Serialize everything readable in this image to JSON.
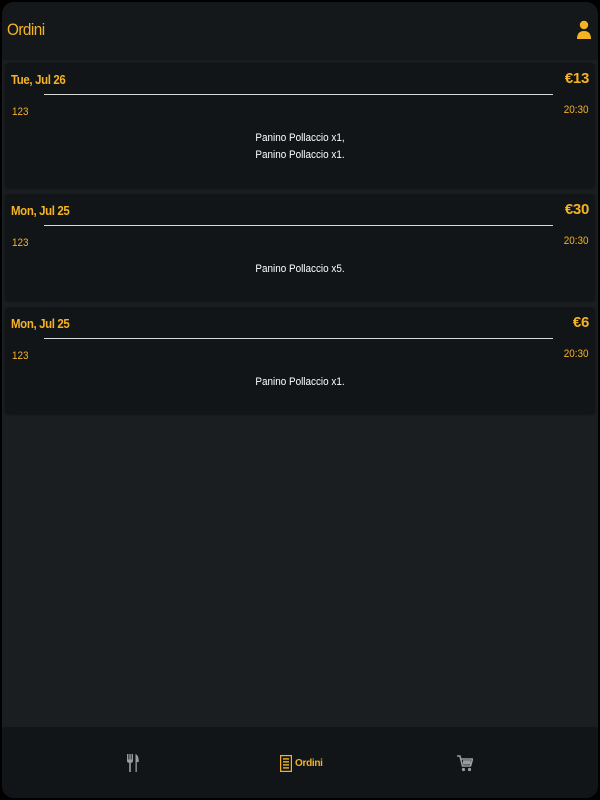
{
  "app_bar": {
    "title": "Ordini",
    "profile_icon": "person-icon"
  },
  "orders": [
    {
      "date": "Tue, Jul 26",
      "total": "€13",
      "code": "123",
      "time": "20:30",
      "items": [
        "Panino Pollaccio x1,",
        "Panino Pollaccio x1."
      ]
    },
    {
      "date": "Mon, Jul 25",
      "total": "€30",
      "code": "123",
      "time": "20:30",
      "items": [
        "Panino Pollaccio x5."
      ]
    },
    {
      "date": "Mon, Jul 25",
      "total": "€6",
      "code": "123",
      "time": "20:30",
      "items": [
        "Panino Pollaccio x1."
      ]
    }
  ],
  "bottom_nav": {
    "menu_icon": "fork-knife-icon",
    "orders_icon": "receipt-icon",
    "orders_label": "Ordini",
    "cart_icon": "cart-icon",
    "active": "orders"
  },
  "colors": {
    "accent": "#f5b323",
    "background": "#1b1e21",
    "card": "#121518",
    "inactive_icon": "#9a9d9f"
  }
}
